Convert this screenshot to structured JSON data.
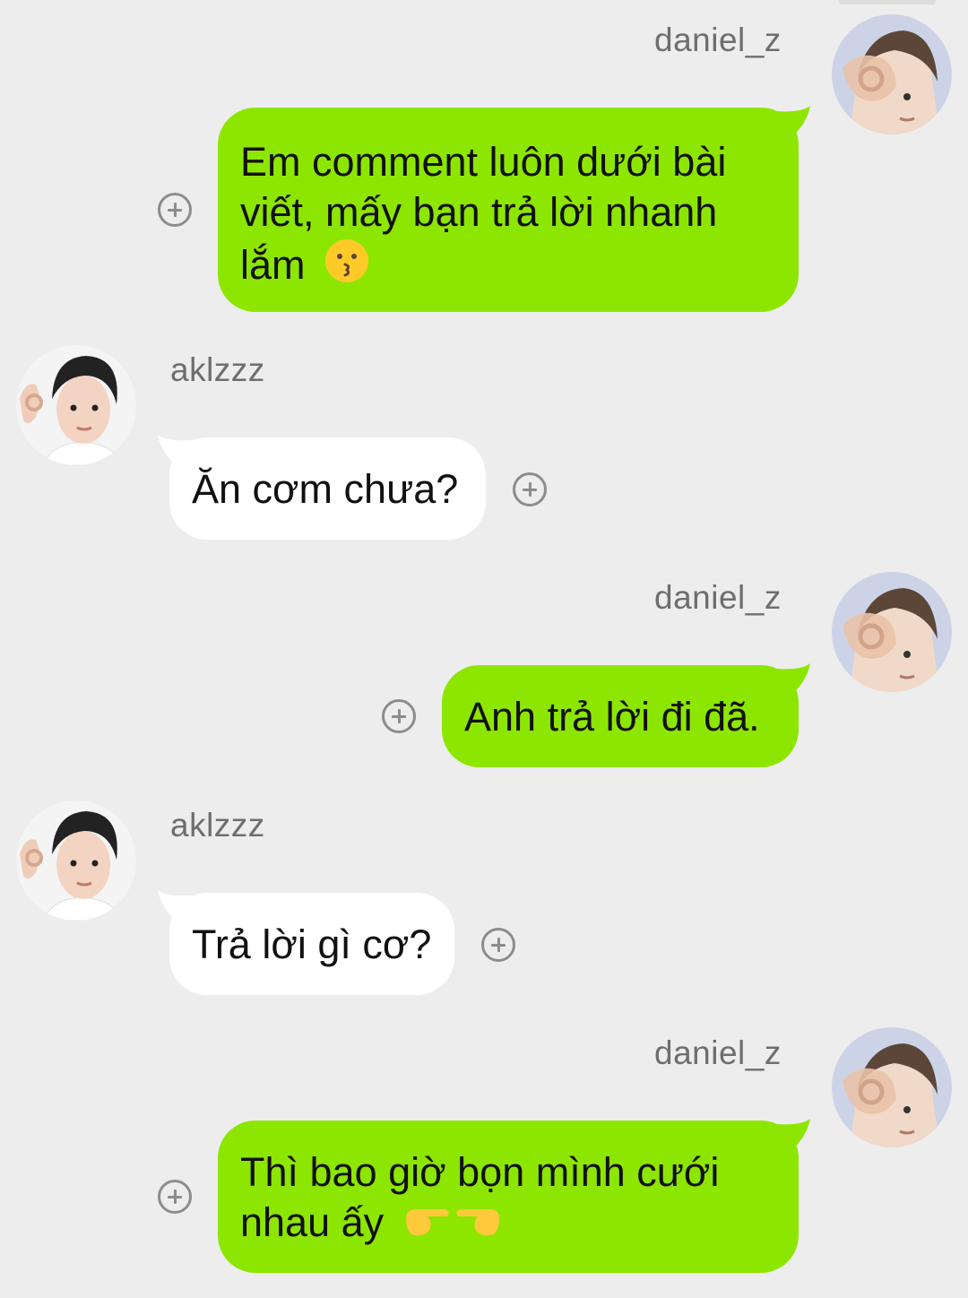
{
  "users": {
    "self": {
      "name": "daniel_z"
    },
    "other": {
      "name": "aklzzz"
    }
  },
  "messages": [
    {
      "from": "daniel_z",
      "side": "out",
      "text": "Em comment luôn dưới bài viết, mấy bạn trả lời nhanh lắm",
      "emoji": "kissing-face-emoji"
    },
    {
      "from": "aklzzz",
      "side": "in",
      "text": "Ăn cơm chưa?"
    },
    {
      "from": "daniel_z",
      "side": "out",
      "text": "Anh trả lời đi đã."
    },
    {
      "from": "aklzzz",
      "side": "in",
      "text": "Trả lời gì cơ?"
    },
    {
      "from": "daniel_z",
      "side": "out",
      "text": "Thì bao giờ bọn mình cưới nhau ấy",
      "emoji": "pointing-hands-emoji"
    }
  ],
  "colors": {
    "background": "#ededed",
    "outgoing_bubble": "#8de600",
    "incoming_bubble": "#ffffff",
    "username": "#6e6e6e"
  }
}
